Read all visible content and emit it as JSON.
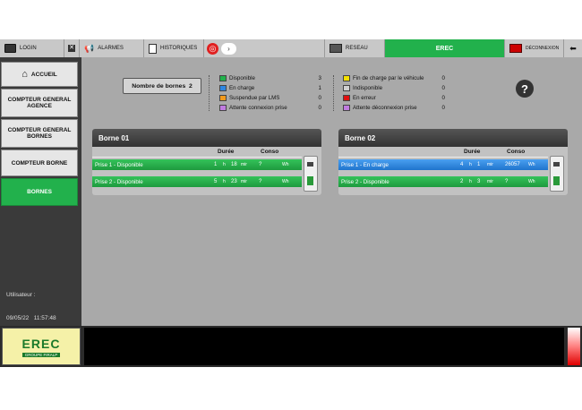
{
  "topbar": {
    "login": "LOGIN",
    "alarmes": "ALARMES",
    "historiques": "HISTORIQUES",
    "reseau": "RESEAU",
    "erec": "EREC",
    "deconnexion": "DÉCONNEXION"
  },
  "sidebar": {
    "accueil": "ACCUEIL",
    "compteur_agence": "COMPTEUR GENERAL AGENCE",
    "compteur_bornes": "COMPTEUR GENERAL BORNES",
    "compteur_borne": "COMPTEUR BORNE",
    "bornes": "BORNES",
    "utilisateur_label": "Utilisateur :",
    "date": "09/05/22",
    "time": "11:57:48"
  },
  "summary": {
    "label": "Nombre de bornes",
    "count": "2"
  },
  "legend_left": [
    {
      "label": "Disponible",
      "value": "3",
      "color": "#22b14c"
    },
    {
      "label": "En charge",
      "value": "1",
      "color": "#2f86e0"
    },
    {
      "label": "Suspendue par LMS",
      "value": "0",
      "color": "#f29a1c"
    },
    {
      "label": "Attente connexion prise",
      "value": "0",
      "color": "#c07be0"
    }
  ],
  "legend_right": [
    {
      "label": "Fin de charge par le véhicule",
      "value": "0",
      "color": "#f5e000"
    },
    {
      "label": "Indisponible",
      "value": "0",
      "color": "#d0d0d0"
    },
    {
      "label": "En erreur",
      "value": "0",
      "color": "#e01010"
    },
    {
      "label": "Attente déconnexion prise",
      "value": "0",
      "color": "#c07be0"
    }
  ],
  "headers": {
    "duree": "Durée",
    "conso": "Conso"
  },
  "bornes": [
    {
      "title": "Borne 01",
      "prises": [
        {
          "label": "Prise 1 - Disponible",
          "h": "1",
          "h_unit": "h",
          "m": "18",
          "m_unit": "mir",
          "conso": "?",
          "conso_unit": "Wh",
          "state": "green"
        },
        {
          "label": "Prise 2 - Disponible",
          "h": "5",
          "h_unit": "h",
          "m": "23",
          "m_unit": "mir",
          "conso": "?",
          "conso_unit": "Wh",
          "state": "green"
        }
      ]
    },
    {
      "title": "Borne 02",
      "prises": [
        {
          "label": "Prise 1 - En charge",
          "h": "4",
          "h_unit": "h",
          "m": "1",
          "m_unit": "mir",
          "conso": "26057",
          "conso_unit": "Wh",
          "state": "blue"
        },
        {
          "label": "Prise 2 - Disponible",
          "h": "2",
          "h_unit": "h",
          "m": "3",
          "m_unit": "mir",
          "conso": "?",
          "conso_unit": "Wh",
          "state": "green"
        }
      ]
    }
  ],
  "logo": {
    "text": "EREC",
    "sub": "GROUPE FIRALP"
  },
  "colors": {
    "accent": "#22b14c",
    "main_bg": "#a9a9a9"
  }
}
